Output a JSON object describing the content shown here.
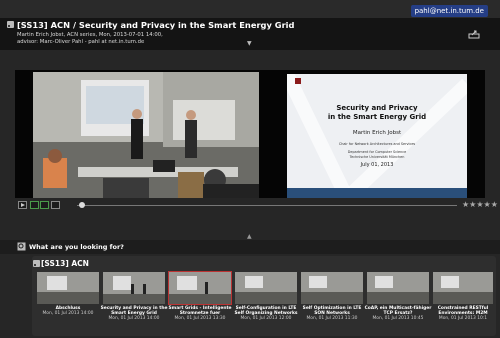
{
  "user": {
    "email": "pahl@net.in.tum.de"
  },
  "lecture": {
    "title": "[SS13] ACN / Security and Privacy in the Smart Energy Grid",
    "subtitle": "Martin Erich Jobst, ACN series, Mon, 2013-07-01 14:00,",
    "advisor": "advisor: Marc-Oliver Pahl - pahl at net.in.tum.de"
  },
  "slide": {
    "title_line1": "Security and Privacy",
    "title_line2": "in the Smart Energy Grid",
    "author": "Martin Erich Jobst",
    "chair": "Chair for Network Architectures and Services",
    "dept1": "Department for Computer Science",
    "dept2": "Technische Universität München",
    "date": "July 01, 2013"
  },
  "player": {
    "rating": "★★★★★"
  },
  "search": {
    "label": "What are you looking for?"
  },
  "series": {
    "title": "[SS13] ACN",
    "items": [
      {
        "title": "Abschluss",
        "date": "Mon, 01 Jul 2013 14:00"
      },
      {
        "title": "Security and Privacy in the Smart Energy Grid",
        "date": "Mon, 01 Jul 2013 14:00"
      },
      {
        "title": "Smart Grids - Intelligente Stromnetze fuer",
        "date": "Mon, 01 Jul 2013 13:30"
      },
      {
        "title": "Self-Configuration in LTE Self Organizing Networks",
        "date": "Mon, 01 Jul 2013 12:00"
      },
      {
        "title": "Self Optimization in LTE SON Networks",
        "date": "Mon, 01 Jul 2013 11:30"
      },
      {
        "title": "CoAP, ein Multicast-fähiger TCP Ersatz?",
        "date": "Mon, 01 Jul 2013 10:45"
      },
      {
        "title": "Constrained RESTful Environments: M2M",
        "date": "Mon, 01 Jul 2013 10:1"
      }
    ]
  },
  "colors": {
    "accent": "#253e86",
    "active_border": "#b33333"
  }
}
